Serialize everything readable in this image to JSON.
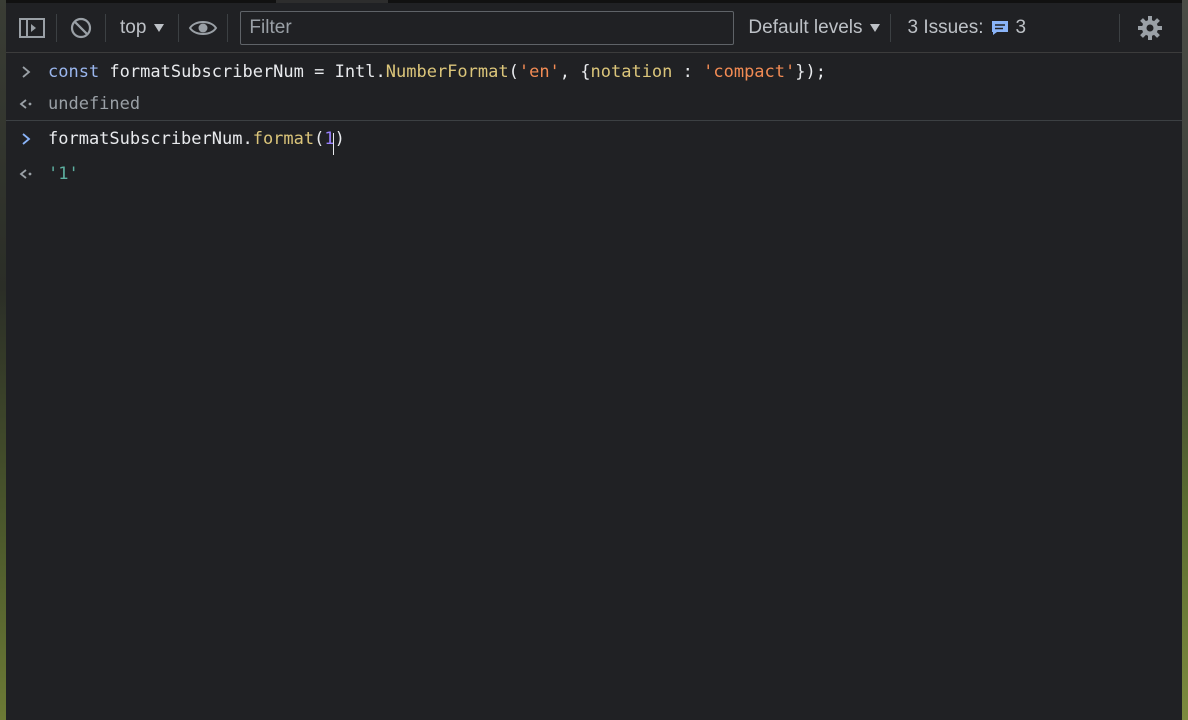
{
  "toolbar": {
    "context_label": "top",
    "filter_placeholder": "Filter",
    "levels_label": "Default levels",
    "issues_label": "3 Issues:",
    "issues_count": "3"
  },
  "console": {
    "entries": [
      {
        "kind": "input",
        "tokens": {
          "t0": "const",
          "t1": " formatSubscriberNum = Intl.",
          "t2": "NumberFormat",
          "t3": "(",
          "t4": "'en'",
          "t5": ", {",
          "t6": "notation",
          "t7": " : ",
          "t8": "'compact'",
          "t9": "});"
        }
      },
      {
        "kind": "result",
        "text": "undefined"
      },
      {
        "kind": "input",
        "tokens": {
          "t0": "formatSubscriberNum.",
          "t1": "format",
          "t2": "(",
          "t3": "1",
          "t4": ")"
        }
      },
      {
        "kind": "result",
        "text": "'1'"
      }
    ]
  },
  "icons": {
    "sidebar_toggle": "sidebar-toggle-icon",
    "clear": "clear-console-icon",
    "eye": "live-expression-eye-icon",
    "issues": "message-icon",
    "settings": "gear-icon"
  },
  "colors": {
    "background": "#202124",
    "keyword": "#9ab6ee",
    "function": "#dbc57a",
    "string": "#f28b54",
    "number": "#9980ff",
    "result_string": "#5db0a0",
    "issues_accent": "#8ab4f8"
  }
}
